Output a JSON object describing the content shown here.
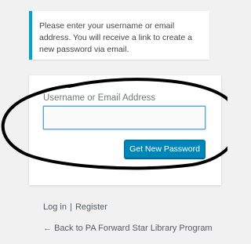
{
  "message": {
    "text": "Please enter your username or email address. You will receive a link to create a new password via email."
  },
  "form": {
    "field_label": "Username or Email Address",
    "field_value": "",
    "submit_label": "Get New Password"
  },
  "nav": {
    "login_label": "Log in",
    "separator": "|",
    "register_label": "Register"
  },
  "back": {
    "arrow": "←",
    "label": "Back to PA Forward Star Library Program"
  },
  "colors": {
    "accent": "#00a0d2",
    "button": "#0085ba",
    "annotation": "#000000"
  }
}
